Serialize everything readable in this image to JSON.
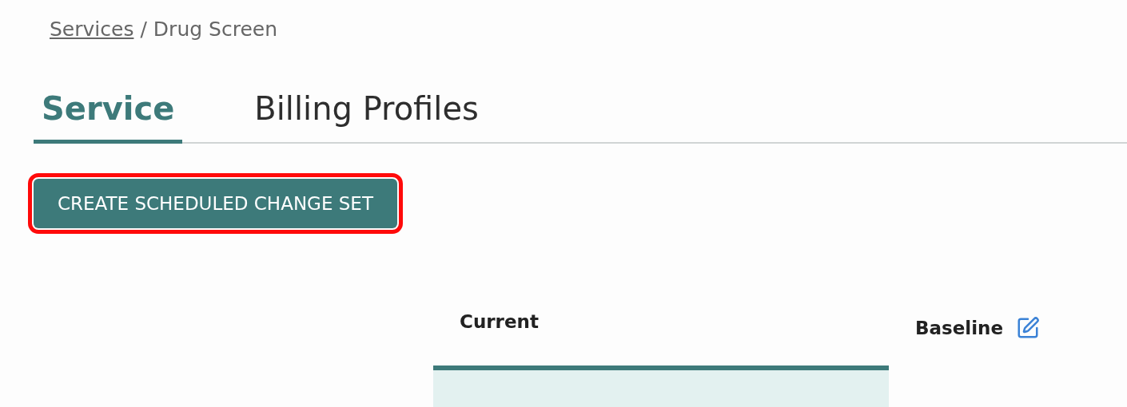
{
  "breadcrumb": {
    "link": "Services",
    "separator": "/",
    "current": "Drug Screen"
  },
  "tabs": [
    {
      "label": "Service",
      "selected": true
    },
    {
      "label": "Billing Profiles",
      "selected": false
    }
  ],
  "action_button": {
    "label": "CREATE SCHEDULED CHANGE SET",
    "highlighted": true
  },
  "columns": [
    {
      "label": "Current",
      "editable": false,
      "active": true
    },
    {
      "label": "Baseline",
      "editable": true,
      "active": false
    }
  ]
}
